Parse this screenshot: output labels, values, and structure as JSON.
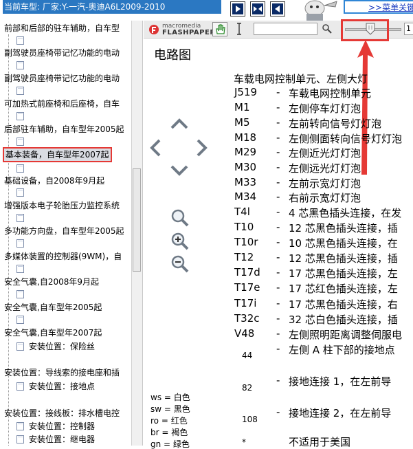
{
  "header": {
    "car_model_label": "当前车型:  厂家:Y-一汽-奥迪A6L2009-2010",
    "menu_link": ">>菜单关键"
  },
  "tree": {
    "items": [
      {
        "label": "前部和后部的驻车辅助，自车型"
      },
      {
        "label": "副驾驶员座椅带记忆功能的电动"
      },
      {
        "label": "副驾驶员座椅带记忆功能的电动"
      },
      {
        "label": "可加热式前座椅和后座椅，自车"
      },
      {
        "label": "后部驻车辅助，自车型年2005起"
      },
      {
        "label": "基本装备，自车型年2007起"
      },
      {
        "label": "基础设备，自2008年9月起"
      },
      {
        "label": "增强版本电子轮胎压力监控系统"
      },
      {
        "label": "多功能方向盘，自车型年2005起"
      },
      {
        "label": "多媒体装置的控制器(9WM)，自"
      },
      {
        "label": "安全气囊,自2008年9月起"
      },
      {
        "label": "安全气囊,自车型年2005起"
      },
      {
        "label": "安全气囊,自车型年2007起"
      },
      {
        "label": "安装位置：保险丝"
      },
      {
        "label": "安装位置：导线索的接电座和插"
      },
      {
        "label": "安装位置：接地点"
      },
      {
        "label": "安装位置：接线板：排水槽电控"
      },
      {
        "label": "安装位置：控制器"
      },
      {
        "label": "安装位置：继电器"
      }
    ]
  },
  "toolbar": {
    "logo_line1": "macromedia",
    "logo_line2": "FLASHPAPER",
    "zoom_value": "1"
  },
  "document": {
    "title": "电路图",
    "heading": "车载电网控制单元、左侧大灯",
    "rows": [
      {
        "code": "J519",
        "desc": "车载电网控制单元"
      },
      {
        "code": "M1",
        "desc": "左侧停车灯灯泡"
      },
      {
        "code": "M5",
        "desc": "左前转向信号灯灯泡"
      },
      {
        "code": "M18",
        "desc": "左侧侧面转向信号灯灯泡"
      },
      {
        "code": "M29",
        "desc": "左侧近光灯灯泡"
      },
      {
        "code": "M30",
        "desc": "左侧远光灯灯泡"
      },
      {
        "code": "M33",
        "desc": "左前示宽灯灯泡"
      },
      {
        "code": "M34",
        "desc": "右前示宽灯灯泡"
      },
      {
        "code": "T4l",
        "desc": "4 芯黑色插头连接，在发"
      },
      {
        "code": "T10",
        "desc": "12 芯黑色插头连接，插"
      },
      {
        "code": "T10r",
        "desc": "10 芯黑色插头连接，在"
      },
      {
        "code": "T12",
        "desc": "12 芯黑色插头连接，插"
      },
      {
        "code": "T17d",
        "desc": "17 芯黑色插头连接，左"
      },
      {
        "code": "T17e",
        "desc": "17 芯红色插头连接，左"
      },
      {
        "code": "T17i",
        "desc": "17 芯黑色插头连接，右"
      },
      {
        "code": "T32c",
        "desc": "32 芯白色插头连接，插"
      },
      {
        "code": "V48",
        "desc": "左侧照明距离调整伺服电"
      }
    ],
    "ground_rows": [
      {
        "code": "44",
        "desc": "左侧  A 柱下部的接地点"
      },
      {
        "code": "82",
        "desc": "接地连接  1，在左前导"
      },
      {
        "code": "108",
        "desc": "接地连接  2，在左前导"
      }
    ],
    "footnote": {
      "code": "*",
      "desc": "不适用于美国"
    },
    "dash": "-",
    "legend": [
      "ws = 白色",
      "sw = 黑色",
      "ro = 红色",
      "br = 褐色",
      "gn = 绿色"
    ]
  }
}
